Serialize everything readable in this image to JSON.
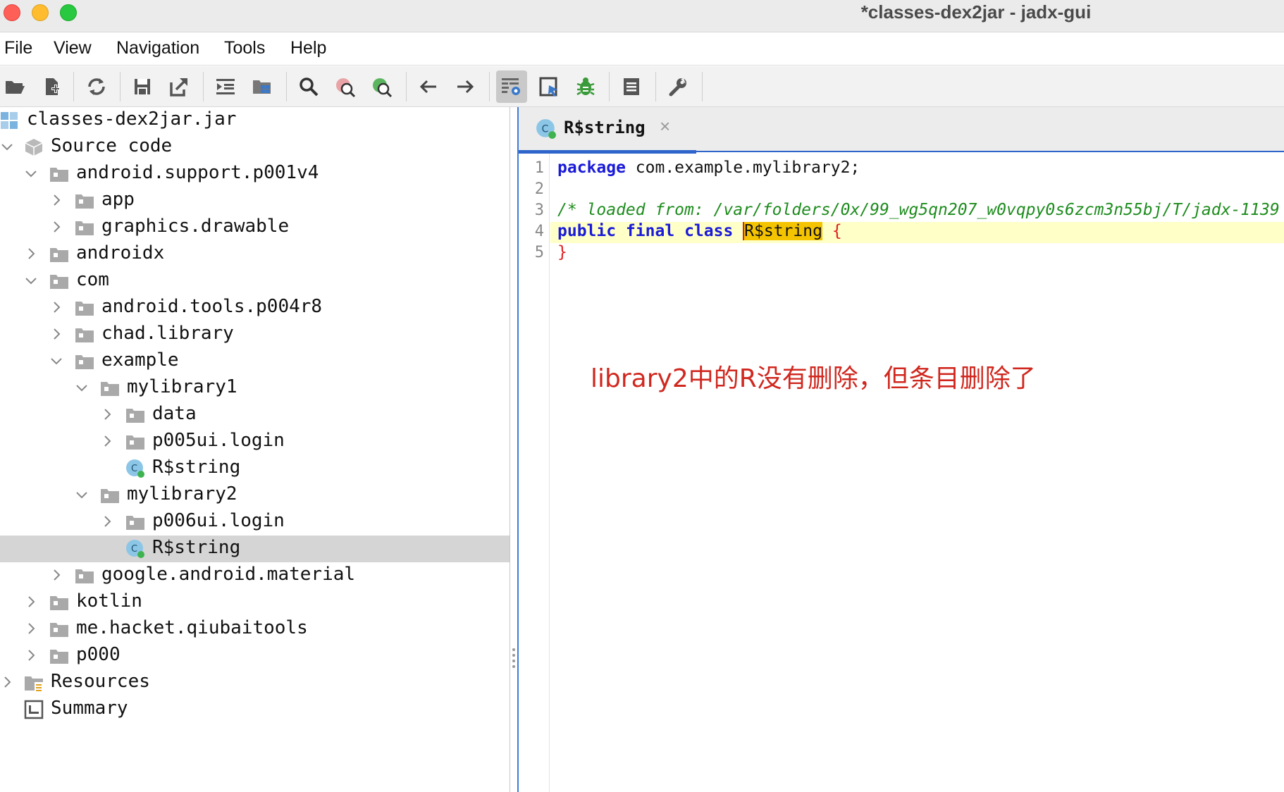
{
  "window": {
    "title": "*classes-dex2jar - jadx-gui"
  },
  "menu": {
    "items": [
      "File",
      "View",
      "Navigation",
      "Tools",
      "Help"
    ]
  },
  "toolbar": {
    "icons": [
      "open-file-icon",
      "add-file-icon",
      "sync-icon",
      "save-icon",
      "export-icon",
      "sync-tree-icon",
      "flatten-packages-icon",
      "search-icon",
      "find-class-icon",
      "find-usage-icon",
      "back-icon",
      "forward-icon",
      "deobfuscation-icon",
      "quick-tabs-icon",
      "debugger-icon",
      "log-icon",
      "preferences-icon"
    ]
  },
  "tree": {
    "root": "classes-dex2jar.jar",
    "nodes": [
      {
        "label": "Source code"
      },
      {
        "label": "android.support.p001v4"
      },
      {
        "label": "app"
      },
      {
        "label": "graphics.drawable"
      },
      {
        "label": "androidx"
      },
      {
        "label": "com"
      },
      {
        "label": "android.tools.p004r8"
      },
      {
        "label": "chad.library"
      },
      {
        "label": "example"
      },
      {
        "label": "mylibrary1"
      },
      {
        "label": "data"
      },
      {
        "label": "p005ui.login"
      },
      {
        "label": "R$string"
      },
      {
        "label": "mylibrary2"
      },
      {
        "label": "p006ui.login"
      },
      {
        "label": "R$string"
      },
      {
        "label": "google.android.material"
      },
      {
        "label": "kotlin"
      },
      {
        "label": "me.hacket.qiubaitools"
      },
      {
        "label": "p000"
      },
      {
        "label": "Resources"
      },
      {
        "label": "Summary"
      }
    ]
  },
  "editor": {
    "tab": {
      "label": "R$string",
      "close": "×"
    },
    "line_numbers": [
      "1",
      "2",
      "3",
      "4",
      "5"
    ],
    "code": {
      "l1_kw": "package",
      "l1_rest": " com.example.mylibrary2;",
      "l3_comment": "/* loaded from: /var/folders/0x/99_wg5qn207_w0vqpy0s6zcm3n55bj/T/jadx-1139",
      "l4_kw1": "public",
      "l4_kw2": "final",
      "l4_kw3": "class",
      "l4_name": "R$string",
      "l4_brace": "{",
      "l5_brace": "}"
    }
  },
  "annotation": "library2中的R没有删除，但条目删除了",
  "colors": {
    "keyword": "#1a1ad8",
    "comment": "#1e8c1e",
    "annotation": "#d0281f",
    "highlight": "#f5c400",
    "tab_accent": "#2f65ca"
  }
}
